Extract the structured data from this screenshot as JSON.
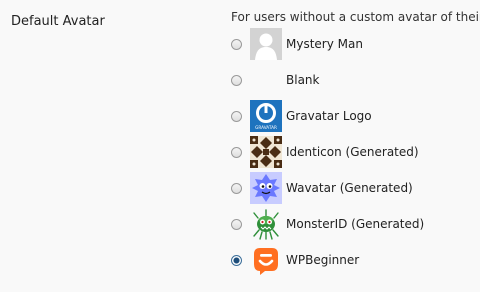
{
  "section": {
    "label": "Default Avatar",
    "description": "For users without a custom avatar of their o"
  },
  "avatar_options": [
    {
      "label": "Mystery Man",
      "icon": "mystery-man-avatar-icon",
      "selected": false
    },
    {
      "label": "Blank",
      "icon": "blank-avatar-icon",
      "selected": false
    },
    {
      "label": "Gravatar Logo",
      "icon": "gravatar-logo-icon",
      "selected": false
    },
    {
      "label": "Identicon (Generated)",
      "icon": "identicon-avatar-icon",
      "selected": false
    },
    {
      "label": "Wavatar (Generated)",
      "icon": "wavatar-avatar-icon",
      "selected": false
    },
    {
      "label": "MonsterID (Generated)",
      "icon": "monsterid-avatar-icon",
      "selected": false
    },
    {
      "label": "WPBeginner",
      "icon": "wpbeginner-avatar-icon",
      "selected": true
    }
  ],
  "icon_text": {
    "gravatar_small": "GRAVATAR"
  },
  "colors": {
    "page_background": "#f9f9f9",
    "gravatar_blue": "#1e73be",
    "wpbeginner_orange": "#ff6f21",
    "identicon_brown": "#4a2d14",
    "wavatar_blue": "#6a78ff",
    "monster_green": "#2f8f3a"
  }
}
